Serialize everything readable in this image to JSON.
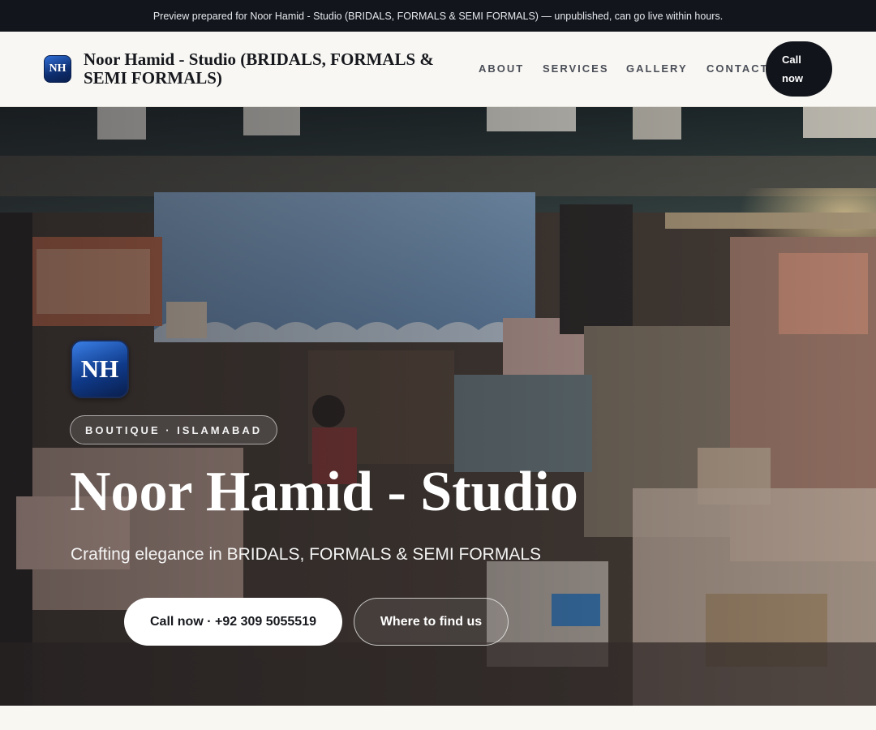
{
  "banner": {
    "text": "Preview prepared for Noor Hamid - Studio (BRIDALS, FORMALS & SEMI FORMALS) — unpublished, can go live within hours."
  },
  "header": {
    "logo_initials": "NH",
    "brand_name": "Noor Hamid - Studio (BRIDALS, FORMALS & SEMI FORMALS)",
    "nav": [
      "ABOUT",
      "SERVICES",
      "GALLERY",
      "CONTACT"
    ],
    "call_label": "Call now"
  },
  "hero": {
    "logo_initials": "NH",
    "tag": "BOUTIQUE · ISLAMABAD",
    "title": "Noor Hamid - Studio",
    "subtitle": "Crafting elegance in BRIDALS, FORMALS & SEMI FORMALS",
    "primary_button": "Call now · +92 309 5055519",
    "secondary_button": "Where to find us"
  }
}
